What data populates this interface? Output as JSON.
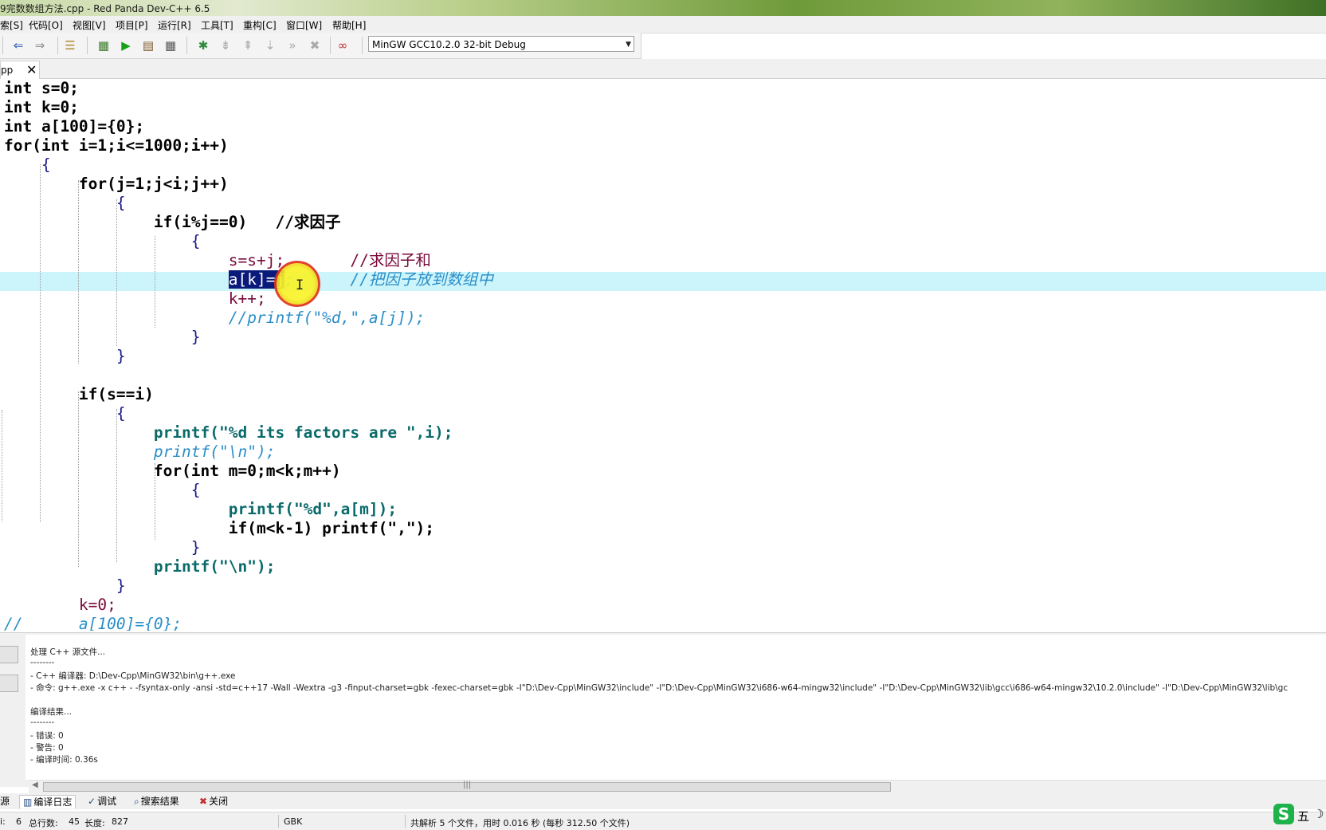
{
  "window": {
    "title": "9完数数组方法.cpp - Red Panda Dev-C++ 6.5"
  },
  "menu": [
    "索[S]",
    "代码[O]",
    "视图[V]",
    "项目[P]",
    "运行[R]",
    "工具[T]",
    "重构[C]",
    "窗口[W]",
    "帮助[H]"
  ],
  "toolbar": {
    "compiler": "MinGW GCC10.2.0 32-bit Debug"
  },
  "tab": {
    "name": "pp",
    "close": "✕"
  },
  "code": [
    "int s=0;",
    "int k=0;",
    "int a[100]={0};",
    "for(int i=1;i<=1000;i++)",
    "    {",
    "        for(j=1;j<i;j++)",
    "            {",
    "                if(i%j==0)   //求因子",
    "                    {",
    "                        s=s+j;       //求因子和",
    "                        a[k]=j;      //把因子放到数组中",
    "                        k++;",
    "                        //printf(\"%d,\",a[j]);",
    "                    }",
    "            }",
    "",
    "        if(s==i)",
    "            {",
    "                printf(\"%d its factors are \",i);",
    "                printf(\"\\n\");",
    "                for(int m=0;m<k;m++)",
    "                    {",
    "                        printf(\"%d\",a[m]);",
    "                        if(m<k-1) printf(\",\");",
    "                    }",
    "                printf(\"\\n\");",
    "            }",
    "        k=0;",
    "//      a[100]={0};"
  ],
  "log": [
    "处理 C++ 源文件...",
    "--------",
    "- C++ 编译器: D:\\Dev-Cpp\\MinGW32\\bin\\g++.exe",
    "- 命令: g++.exe -x c++ - -fsyntax-only -ansi -std=c++17 -Wall -Wextra -g3 -finput-charset=gbk -fexec-charset=gbk -I\"D:\\Dev-Cpp\\MinGW32\\include\" -I\"D:\\Dev-Cpp\\MinGW32\\i686-w64-mingw32\\include\" -I\"D:\\Dev-Cpp\\MinGW32\\lib\\gcc\\i686-w64-mingw32\\10.2.0\\include\" -I\"D:\\Dev-Cpp\\MinGW32\\lib\\gc",
    "",
    "编译结果...",
    "--------",
    "- 错误: 0",
    "- 警告: 0",
    "- 编译时间: 0.36s"
  ],
  "panel_tabs": {
    "source": "源",
    "compile_log": "编译日志",
    "debug": "调试",
    "search": "搜索结果",
    "close": "关闭"
  },
  "status": {
    "line_label": "i:",
    "line": "6",
    "total_label": "总行数:",
    "total": "45",
    "length_label": "长度:",
    "length": "827",
    "encoding": "GBK",
    "parse": "共解析 5 个文件，用时 0.016 秒 (每秒 312.50 个文件)"
  },
  "ime": {
    "logo": "S",
    "mode": "五"
  }
}
